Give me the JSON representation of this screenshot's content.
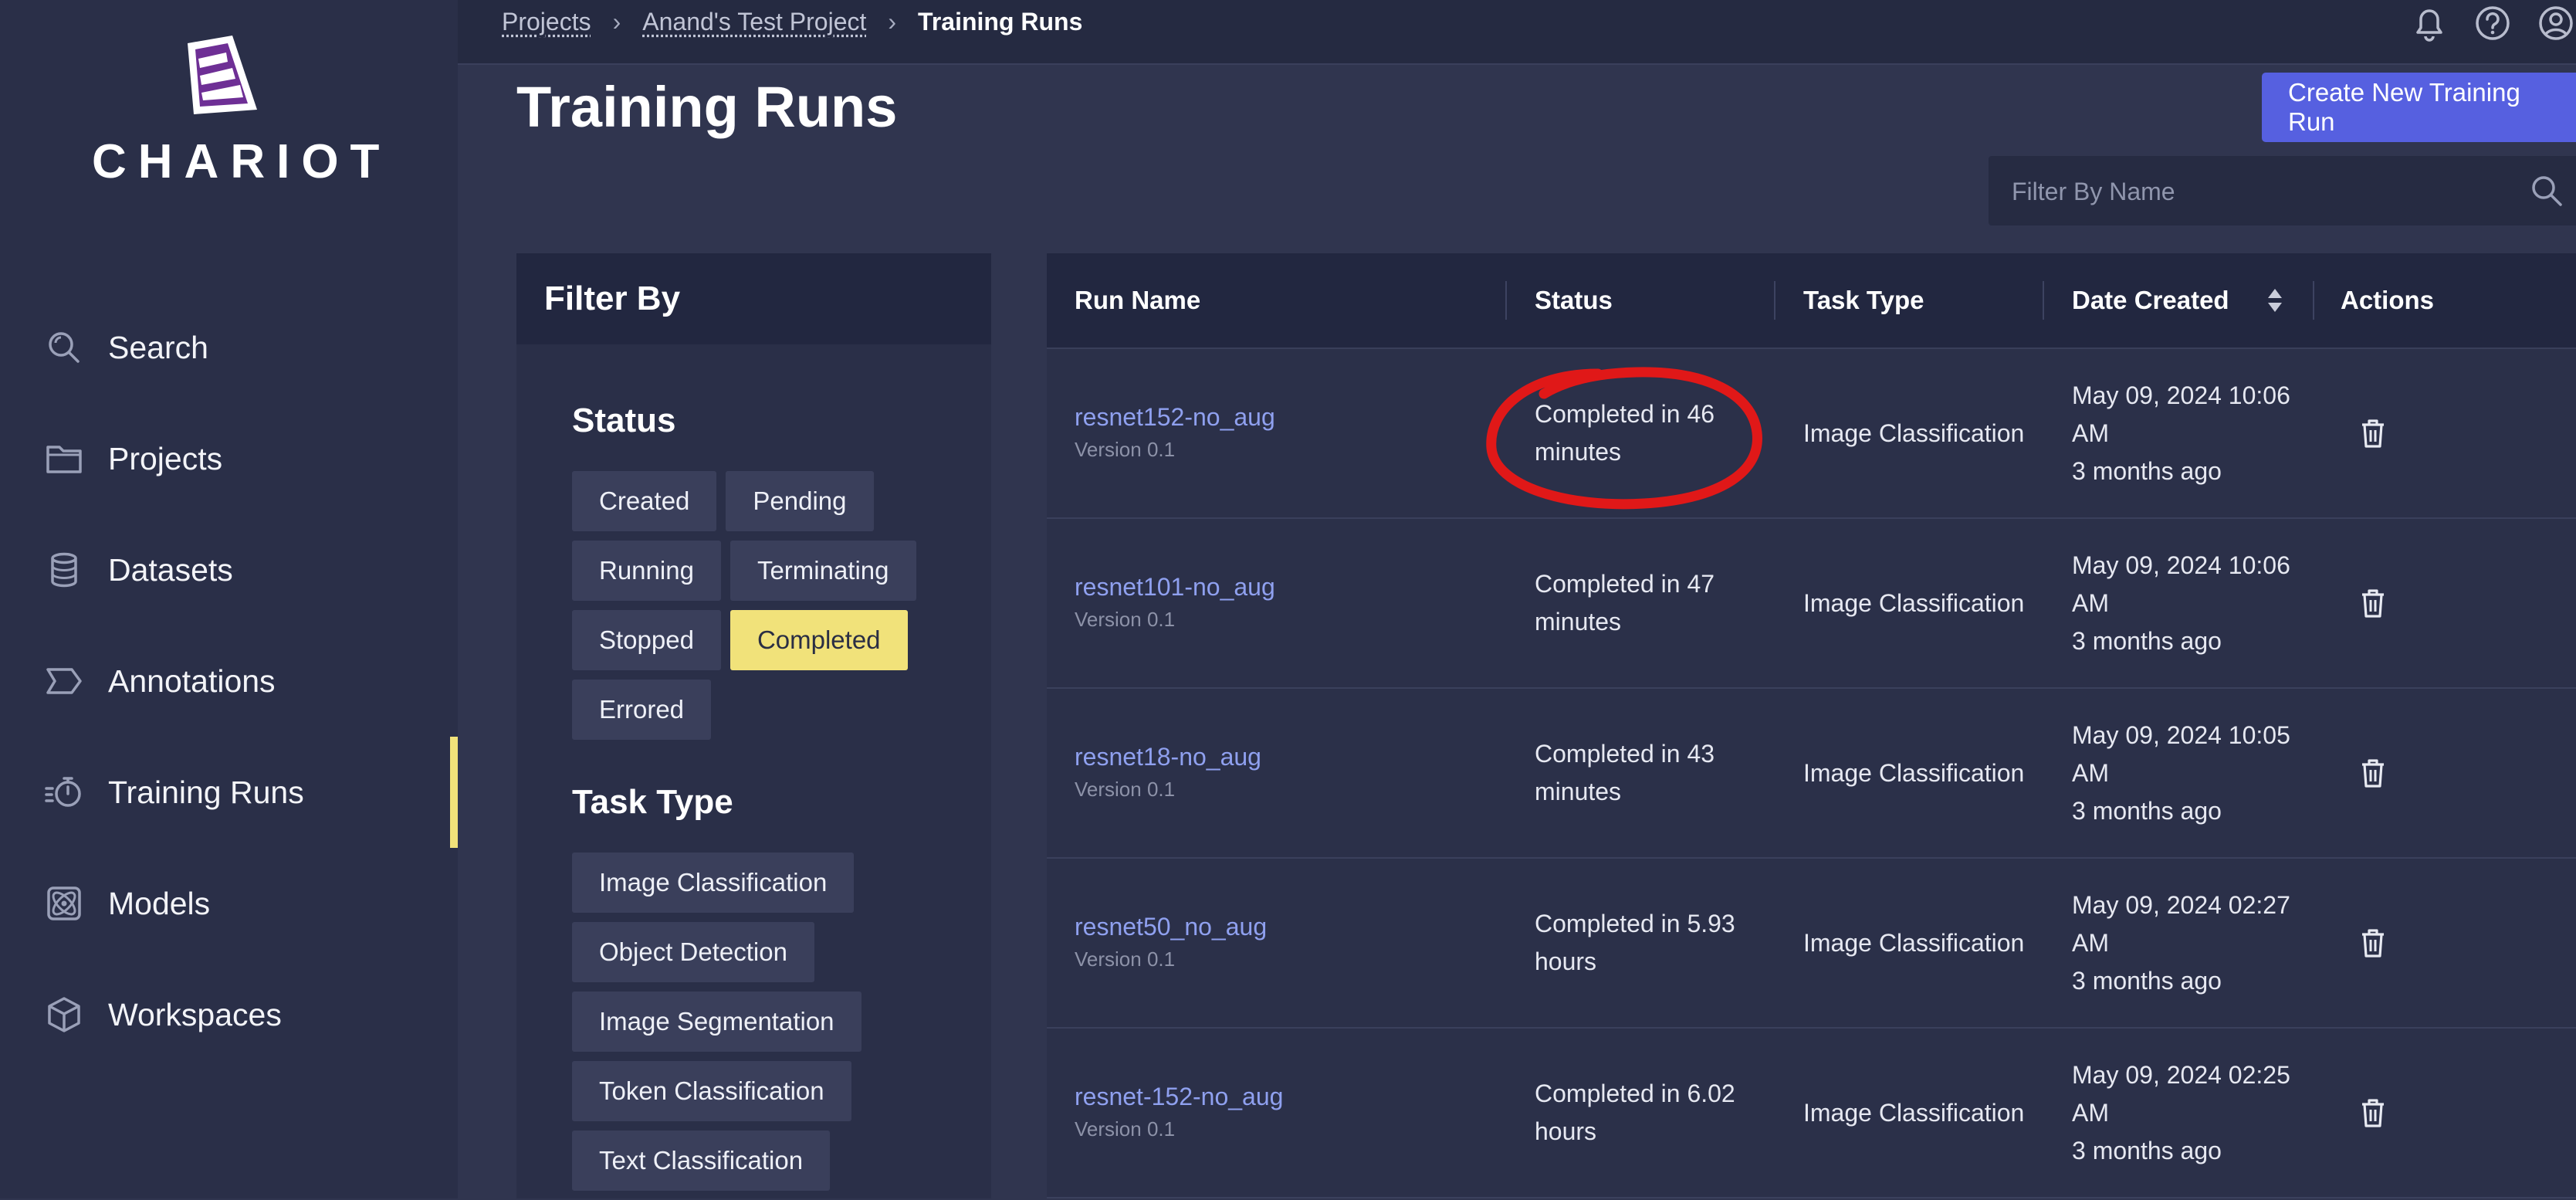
{
  "app": {
    "logo_text": "CHARIOT"
  },
  "sidebar": {
    "items": [
      {
        "label": "Search",
        "icon": "search-icon"
      },
      {
        "label": "Projects",
        "icon": "folder-icon"
      },
      {
        "label": "Datasets",
        "icon": "database-icon"
      },
      {
        "label": "Annotations",
        "icon": "annotation-icon"
      },
      {
        "label": "Training Runs",
        "icon": "stopwatch-icon",
        "active": true
      },
      {
        "label": "Models",
        "icon": "atom-icon"
      },
      {
        "label": "Workspaces",
        "icon": "cube-icon"
      }
    ]
  },
  "breadcrumb": {
    "items": [
      "Projects",
      "Anand's Test Project"
    ],
    "current": "Training Runs"
  },
  "header_icons": [
    "bell-icon",
    "help-icon",
    "user-account-icon"
  ],
  "page": {
    "title": "Training Runs",
    "create_button": "Create New Training Run",
    "filter_placeholder": "Filter By Name"
  },
  "filters": {
    "heading": "Filter By",
    "status": {
      "title": "Status",
      "options": [
        "Created",
        "Pending",
        "Running",
        "Terminating",
        "Stopped",
        "Completed",
        "Errored"
      ],
      "selected": "Completed"
    },
    "task_type": {
      "title": "Task Type",
      "options": [
        "Image Classification",
        "Object Detection",
        "Image Segmentation",
        "Token Classification",
        "Text Classification"
      ]
    }
  },
  "table": {
    "columns": [
      "Run Name",
      "Status",
      "Task Type",
      "Date Created",
      "Actions"
    ],
    "rows": [
      {
        "name": "resnet152-no_aug",
        "version": "Version 0.1",
        "status_line1": "Completed in 46",
        "status_line2": "minutes",
        "task_type": "Image Classification",
        "date_line1": "May 09, 2024 10:06",
        "date_line2": "AM",
        "relative": "3 months ago"
      },
      {
        "name": "resnet101-no_aug",
        "version": "Version 0.1",
        "status_line1": "Completed in 47",
        "status_line2": "minutes",
        "task_type": "Image Classification",
        "date_line1": "May 09, 2024 10:06",
        "date_line2": "AM",
        "relative": "3 months ago"
      },
      {
        "name": "resnet18-no_aug",
        "version": "Version 0.1",
        "status_line1": "Completed in 43",
        "status_line2": "minutes",
        "task_type": "Image Classification",
        "date_line1": "May 09, 2024 10:05",
        "date_line2": "AM",
        "relative": "3 months ago"
      },
      {
        "name": "resnet50_no_aug",
        "version": "Version 0.1",
        "status_line1": "Completed in 5.93",
        "status_line2": "hours",
        "task_type": "Image Classification",
        "date_line1": "May 09, 2024 02:27",
        "date_line2": "AM",
        "relative": "3 months ago"
      },
      {
        "name": "resnet-152-no_aug",
        "version": "Version 0.1",
        "status_line1": "Completed in 6.02",
        "status_line2": "hours",
        "task_type": "Image Classification",
        "date_line1": "May 09, 2024 02:25",
        "date_line2": "AM",
        "relative": "3 months ago"
      }
    ]
  },
  "colors": {
    "accent": "#5660e0",
    "active_chip": "#f1e27a",
    "link": "#8fa0ef",
    "annotation_circle": "#e01818"
  }
}
